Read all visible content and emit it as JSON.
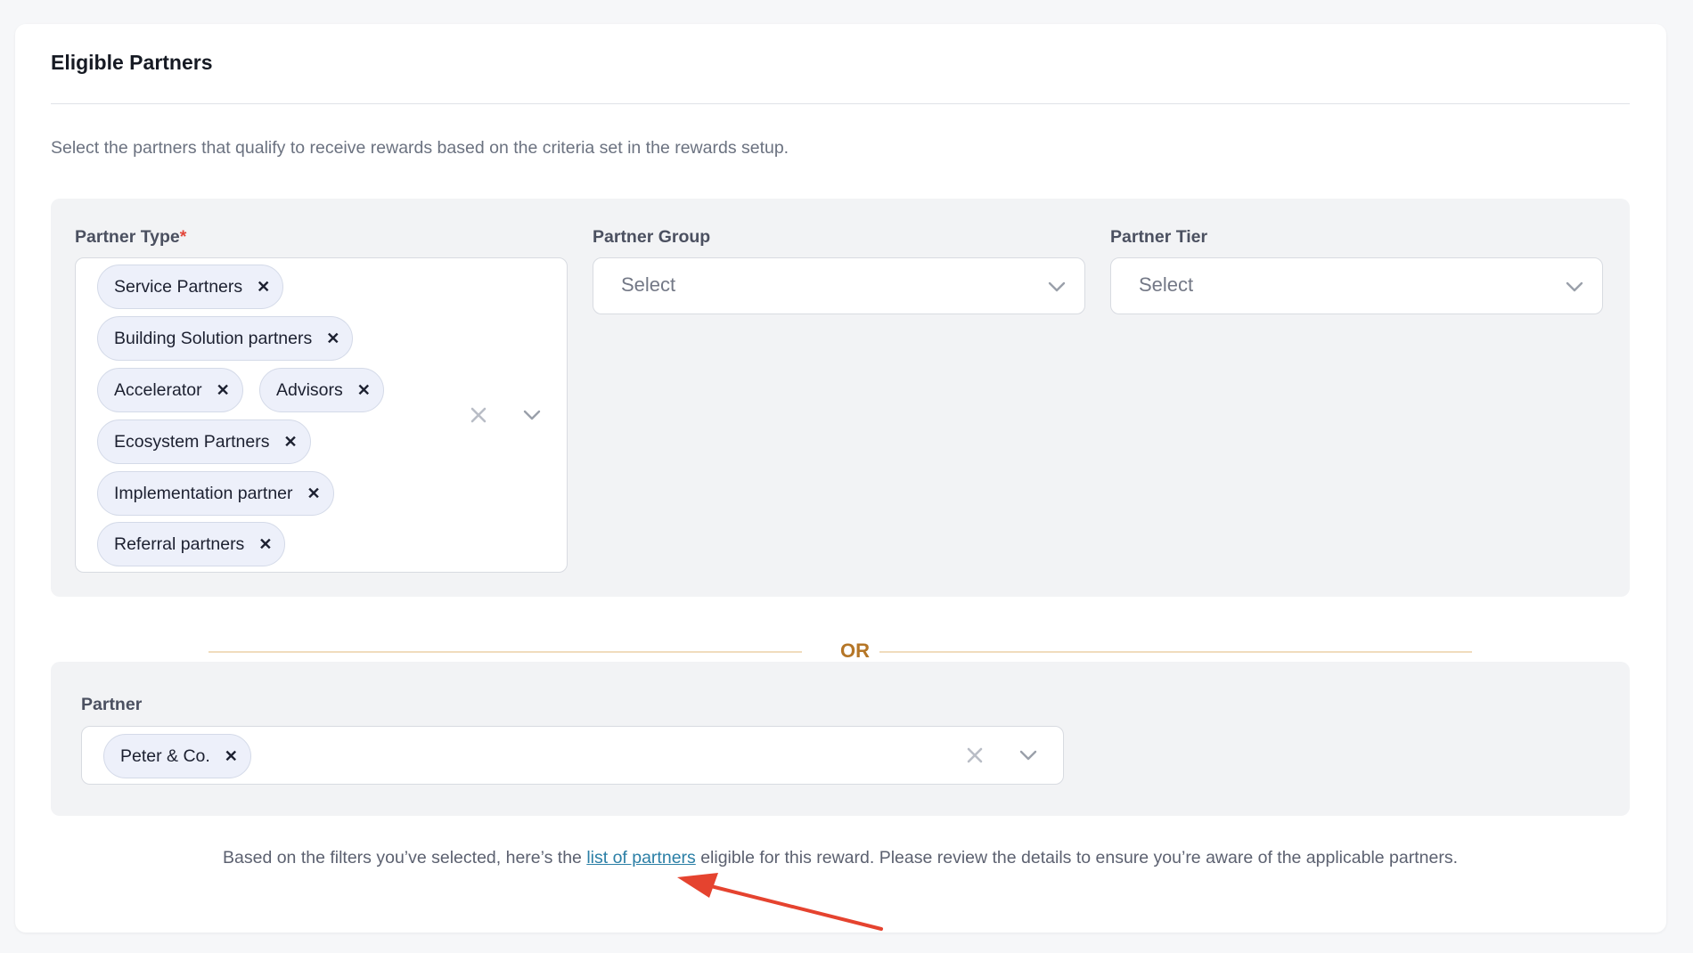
{
  "section": {
    "title": "Eligible Partners",
    "description": "Select the partners that qualify to receive rewards based on the criteria set in the rewards setup."
  },
  "filters": {
    "partner_type": {
      "label": "Partner Type",
      "required_mark": "*",
      "selected": [
        "Service Partners",
        "Building Solution partners",
        "Accelerator",
        "Advisors",
        "Ecosystem Partners",
        "Implementation partner",
        "Referral partners"
      ]
    },
    "partner_group": {
      "label": "Partner Group",
      "placeholder": "Select"
    },
    "partner_tier": {
      "label": "Partner Tier",
      "placeholder": "Select"
    }
  },
  "divider": {
    "text": "OR"
  },
  "partner": {
    "label": "Partner",
    "selected": [
      "Peter & Co."
    ]
  },
  "footer": {
    "text_before": "Based on the filters you’ve selected, here’s the ",
    "link_text": "list of partners",
    "text_after": " eligible for this reward. Please review the details to ensure you’re aware of the applicable partners."
  },
  "icons": {
    "chip_remove": "close-icon",
    "clear_all": "clear-icon",
    "dropdown": "chevron-down-icon",
    "annotation": "red-arrow-icon"
  },
  "colors": {
    "required": "#e2463a",
    "or_text": "#b57627",
    "or_line": "#f0dcbd",
    "link": "#2b7fa6",
    "annotation_arrow": "#e5432f"
  }
}
